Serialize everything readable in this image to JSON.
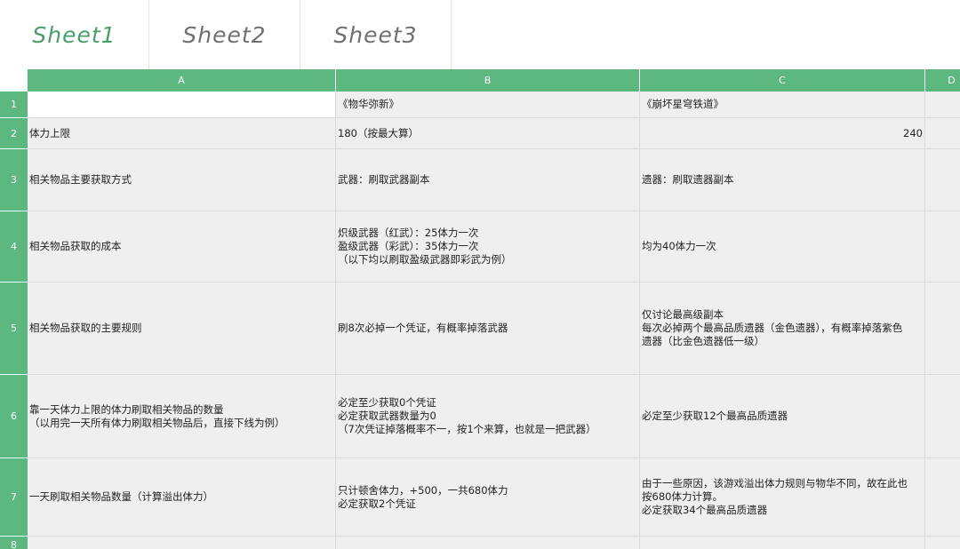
{
  "tabs": [
    {
      "label": "Sheet1",
      "active": true
    },
    {
      "label": "Sheet2",
      "active": false
    },
    {
      "label": "Sheet3",
      "active": false
    }
  ],
  "columns": [
    "A",
    "B",
    "C",
    "D"
  ],
  "rows": [
    "1",
    "2",
    "3",
    "4",
    "5",
    "6",
    "7",
    "8"
  ],
  "cells": {
    "r1": {
      "a": "",
      "b": [
        "《物华弥新》"
      ],
      "c": [
        "《崩坏星穹铁道》"
      ]
    },
    "r2": {
      "a": [
        "体力上限"
      ],
      "b": [
        "180（按最大算）"
      ],
      "c": [
        "240"
      ]
    },
    "r3": {
      "a": [
        "相关物品主要获取方式"
      ],
      "b": [
        "武器：刷取武器副本"
      ],
      "c": [
        "遗器：刷取遗器副本"
      ]
    },
    "r4": {
      "a": [
        "相关物品获取的成本"
      ],
      "b": [
        "炽级武器（红武）：25体力一次",
        "盈级武器（彩武）：35体力一次",
        "（以下均以刷取盈级武器即彩武为例）"
      ],
      "c": [
        "均为40体力一次"
      ]
    },
    "r5": {
      "a": [
        "相关物品获取的主要规则"
      ],
      "b": [
        "刷8次必掉一个凭证，有概率掉落武器"
      ],
      "c": [
        "仅讨论最高级副本",
        "每次必掉两个最高品质遗器（金色遗器），有概率掉落紫色",
        "遗器（比金色遗器低一级）"
      ]
    },
    "r6": {
      "a": [
        "靠一天体力上限的体力刷取相关物品的数量",
        "（以用完一天所有体力刷取相关物品后，直接下线为例）"
      ],
      "b": [
        "必定至少获取0个凭证",
        "必定获取武器数量为0",
        "（7次凭证掉落概率不一，按1个来算，也就是一把武器）"
      ],
      "c": [
        "必定至少获取12个最高品质遗器"
      ]
    },
    "r7": {
      "a": [
        "一天刷取相关物品数量（计算溢出体力）"
      ],
      "b": [
        "只计顿舍体力，+500，一共680体力",
        "必定获取2个凭证"
      ],
      "c": [
        "由于一些原因，该游戏溢出体力规则与物华不同，故在此也",
        "按680体力计算。",
        "必定获取34个最高品质遗器"
      ]
    },
    "r8": {
      "a": "",
      "b": "",
      "c": ""
    }
  }
}
